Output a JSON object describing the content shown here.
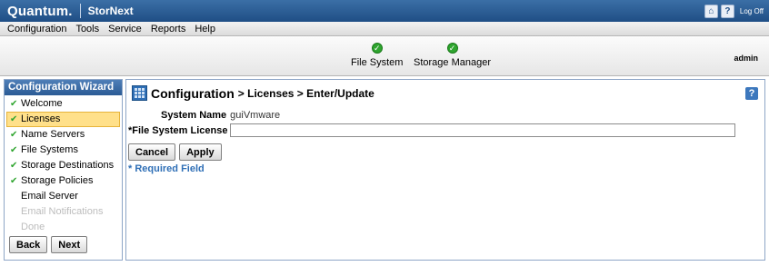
{
  "app": {
    "brand": "Quantum.",
    "product": "StorNext",
    "logoff_label": "Log Off"
  },
  "menu": [
    "Configuration",
    "Tools",
    "Service",
    "Reports",
    "Help"
  ],
  "status": {
    "items": [
      {
        "label": "File System",
        "state": "ok"
      },
      {
        "label": "Storage Manager",
        "state": "ok"
      }
    ],
    "user": "admin"
  },
  "wizard": {
    "title": "Configuration Wizard",
    "steps": [
      {
        "label": "Welcome",
        "done": true
      },
      {
        "label": "Licenses",
        "done": true,
        "active": true
      },
      {
        "label": "Name Servers",
        "done": true
      },
      {
        "label": "File Systems",
        "done": true
      },
      {
        "label": "Storage Destinations",
        "done": true
      },
      {
        "label": "Storage Policies",
        "done": true
      },
      {
        "label": "Email Server",
        "done": false
      },
      {
        "label": "Email Notifications",
        "done": false,
        "disabled": true
      },
      {
        "label": "Done",
        "done": false,
        "disabled": true
      }
    ],
    "back_label": "Back",
    "next_label": "Next"
  },
  "page": {
    "title": "Configuration",
    "path": "> Licenses > Enter/Update",
    "help_label": "?",
    "system_name_label": "System Name",
    "system_name_value": "guiVmware",
    "license_label": "*File System License",
    "license_value": "",
    "cancel_label": "Cancel",
    "apply_label": "Apply",
    "required_note": "* Required Field"
  },
  "colors": {
    "titlebar": "#1f4e85",
    "ok_status": "#2fa52f",
    "active_step": "#ffe08a",
    "required_note": "#2f6fb6"
  }
}
